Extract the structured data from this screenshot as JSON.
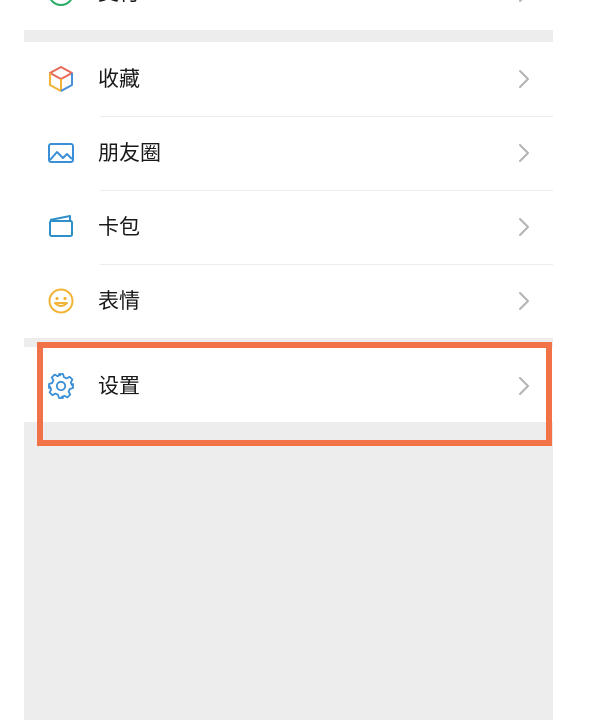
{
  "menu": {
    "items": [
      {
        "label": "支付",
        "icon": "wechat-pay-icon"
      },
      {
        "label": "收藏",
        "icon": "favorites-cube-icon"
      },
      {
        "label": "朋友圈",
        "icon": "moments-image-icon"
      },
      {
        "label": "卡包",
        "icon": "card-wallet-icon"
      },
      {
        "label": "表情",
        "icon": "sticker-smile-icon"
      },
      {
        "label": "设置",
        "icon": "settings-gear-icon"
      }
    ]
  },
  "colors": {
    "highlight": "#f07246",
    "background": "#ededed",
    "row": "#ffffff",
    "chevron": "#b3b3b3"
  }
}
